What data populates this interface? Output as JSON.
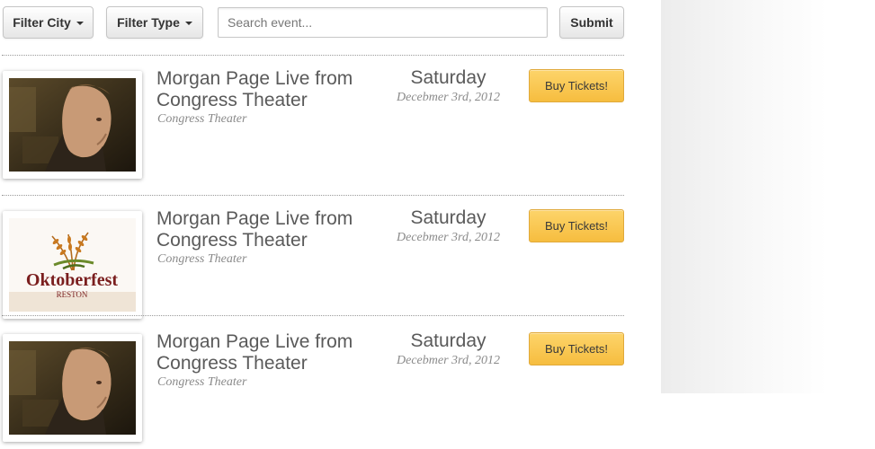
{
  "toolbar": {
    "filter_city_label": "Filter City",
    "filter_type_label": "Filter Type",
    "search_placeholder": "Search event...",
    "search_value": "",
    "submit_label": "Submit"
  },
  "events": [
    {
      "title_line1": "Morgan Page Live from",
      "title_line2": "Congress Theater",
      "venue": "Congress Theater",
      "day": "Saturday",
      "date": "Decebmer 3rd, 2012",
      "buy_label": "Buy Tickets!",
      "image": "artist-photo"
    },
    {
      "title_line1": "Morgan Page Live from",
      "title_line2": "Congress Theater",
      "venue": "Congress Theater",
      "day": "Saturday",
      "date": "Decebmer 3rd, 2012",
      "buy_label": "Buy Tickets!",
      "image": "oktoberfest-logo",
      "logo_text": "Oktoberfest",
      "logo_subtext": "RESTON"
    },
    {
      "title_line1": "Morgan Page Live from",
      "title_line2": "Congress Theater",
      "venue": "Congress Theater",
      "day": "Saturday",
      "date": "Decebmer 3rd, 2012",
      "buy_label": "Buy Tickets!",
      "image": "artist-photo"
    }
  ],
  "colors": {
    "buy_button": "#f9c64d",
    "title_text": "#5a5a5a",
    "meta_text": "#8a8a8a",
    "logo_red": "#7a1e1e"
  }
}
